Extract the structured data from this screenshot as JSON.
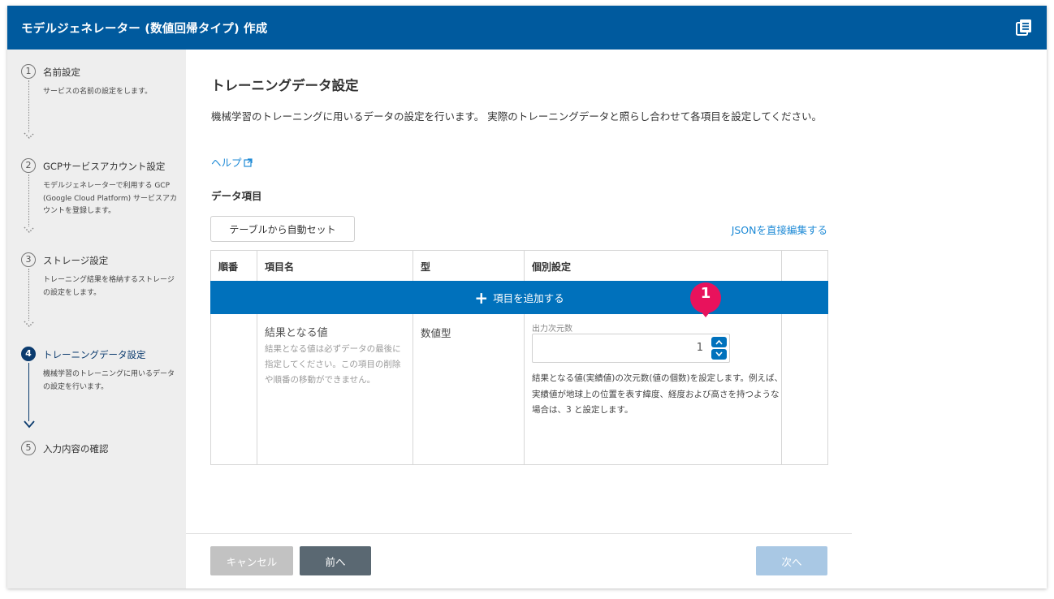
{
  "header": {
    "title": "モデルジェネレーター (数値回帰タイプ) 作成",
    "icon": "document-list-icon"
  },
  "steps": [
    {
      "num": "1",
      "title": "名前設定",
      "desc": "サービスの名前の設定をします。"
    },
    {
      "num": "2",
      "title": "GCPサービスアカウント設定",
      "desc": "モデルジェネレーターで利用する GCP (Google Cloud Platform) サービスアカウントを登録します。"
    },
    {
      "num": "3",
      "title": "ストレージ設定",
      "desc": "トレーニング結果を格納するストレージの設定をします。"
    },
    {
      "num": "4",
      "title": "トレーニングデータ設定",
      "desc": "機械学習のトレーニングに用いるデータの設定を行います。"
    },
    {
      "num": "5",
      "title": "入力内容の確認",
      "desc": ""
    }
  ],
  "main": {
    "title": "トレーニングデータ設定",
    "description": "機械学習のトレーニングに用いるデータの設定を行います。 実際のトレーニングデータと照らし合わせて各項目を設定してください。",
    "help": "ヘルプ",
    "data_section_title": "データ項目",
    "auto_set_button": "テーブルから自動セット",
    "json_link": "JSONを直接編集する",
    "badge": "1",
    "table": {
      "headers": [
        "順番",
        "項目名",
        "型",
        "個別設定"
      ],
      "add_row_label": "項目を追加する",
      "row": {
        "name": "結果となる値",
        "name_desc": "結果となる値は必ずデータの最後に指定してください。この項目の削除や順番の移動ができません。",
        "type": "数値型",
        "output_dim_label": "出力次元数",
        "output_dim_value": "1",
        "setting_desc": "結果となる値(実績値)の次元数(値の個数)を設定します。例えば、実績値が地球上の位置を表す緯度、経度および高さを持つような場合は、3 と設定します。"
      }
    }
  },
  "footer": {
    "cancel": "キャンセル",
    "prev": "前へ",
    "next": "次へ"
  },
  "colors": {
    "header": "#005a9e",
    "accent": "#0071bc",
    "badge": "#e8125c",
    "active_step": "#0b3b6e"
  }
}
